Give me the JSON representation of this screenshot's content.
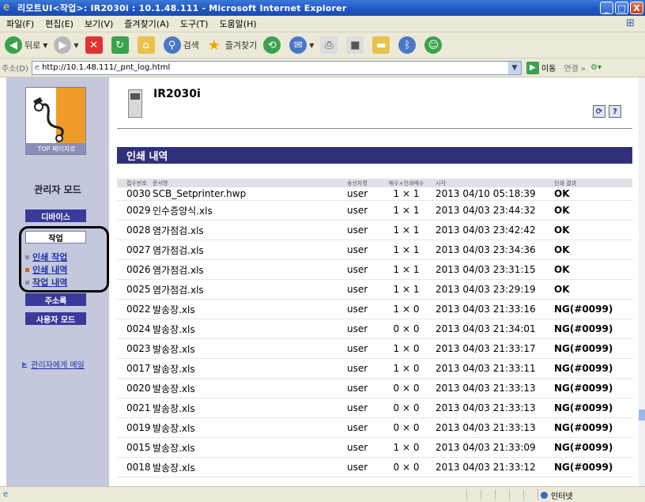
{
  "window": {
    "title": "리모트UI<작업>: IR2030i : 10.1.48.111 - Microsoft Internet Explorer",
    "buttons": {
      "minimize": "_",
      "maximize": "□",
      "close": "X"
    }
  },
  "menubar": [
    "파일(F)",
    "편집(E)",
    "보기(V)",
    "즐겨찾기(A)",
    "도구(T)",
    "도움말(H)"
  ],
  "toolbar": {
    "back": "뒤로",
    "search": "검색",
    "favorites": "즐겨찾기"
  },
  "addressbar": {
    "label": "주소(D)",
    "url": "http://10.1.48.111/_pnt_log.html",
    "go": "이동",
    "links": "연결"
  },
  "sidebar": {
    "top_page": "TOP 페이지로",
    "admin_mode": "관리자 모드",
    "device": "디바이스",
    "job": "작업",
    "links": [
      "인쇄 작업",
      "인쇄 내역",
      "작업 내역"
    ],
    "address_book": "주소록",
    "user_mode": "사용자 모드",
    "mail_admin": "관리자에게 메일"
  },
  "main": {
    "device_name": "IR2030i",
    "section_title": "인쇄 내역",
    "header_buttons": {
      "refresh": "⟳",
      "help": "?"
    }
  },
  "table": {
    "columns": [
      "접수번호",
      "문서명",
      "송신자명",
      "매수×인쇄매수",
      "시각",
      "인쇄 결과"
    ],
    "rows": [
      [
        "0030",
        "SCB_Setprinter.hwp",
        "user",
        "1 × 1",
        "2013 04/10 05:18:39",
        "OK"
      ],
      [
        "0029",
        "인수증양식.xls",
        "user",
        "1 × 1",
        "2013 04/03 23:44:32",
        "OK"
      ],
      [
        "0028",
        "염가점검.xls",
        "user",
        "1 × 1",
        "2013 04/03 23:42:42",
        "OK"
      ],
      [
        "0027",
        "염가점검.xls",
        "user",
        "1 × 1",
        "2013 04/03 23:34:36",
        "OK"
      ],
      [
        "0026",
        "염가점검.xls",
        "user",
        "1 × 1",
        "2013 04/03 23:31:15",
        "OK"
      ],
      [
        "0025",
        "염가점검.xls",
        "user",
        "1 × 1",
        "2013 04/03 23:29:19",
        "OK"
      ],
      [
        "0022",
        "발송장.xls",
        "user",
        "1 × 0",
        "2013 04/03 21:33:16",
        "NG(#0099)"
      ],
      [
        "0024",
        "발송장.xls",
        "user",
        "0 × 0",
        "2013 04/03 21:34:01",
        "NG(#0099)"
      ],
      [
        "0023",
        "발송장.xls",
        "user",
        "1 × 0",
        "2013 04/03 21:33:17",
        "NG(#0099)"
      ],
      [
        "0017",
        "발송장.xls",
        "user",
        "1 × 0",
        "2013 04/03 21:33:11",
        "NG(#0099)"
      ],
      [
        "0020",
        "발송장.xls",
        "user",
        "0 × 0",
        "2013 04/03 21:33:13",
        "NG(#0099)"
      ],
      [
        "0021",
        "발송장.xls",
        "user",
        "0 × 0",
        "2013 04/03 21:33:13",
        "NG(#0099)"
      ],
      [
        "0019",
        "발송장.xls",
        "user",
        "0 × 0",
        "2013 04/03 21:33:13",
        "NG(#0099)"
      ],
      [
        "0015",
        "발송장.xls",
        "user",
        "1 × 0",
        "2013 04/03 21:33:09",
        "NG(#0099)"
      ],
      [
        "0018",
        "발송장.xls",
        "user",
        "0 × 0",
        "2013 04/03 21:33:12",
        "NG(#0099)"
      ]
    ]
  },
  "statusbar": {
    "zone": "인터넷"
  },
  "colors": {
    "sidebar_bg": "#c4c8dd",
    "section_bar": "#30307a",
    "nav_button": "#3a3a9a",
    "link": "#2233aa"
  }
}
